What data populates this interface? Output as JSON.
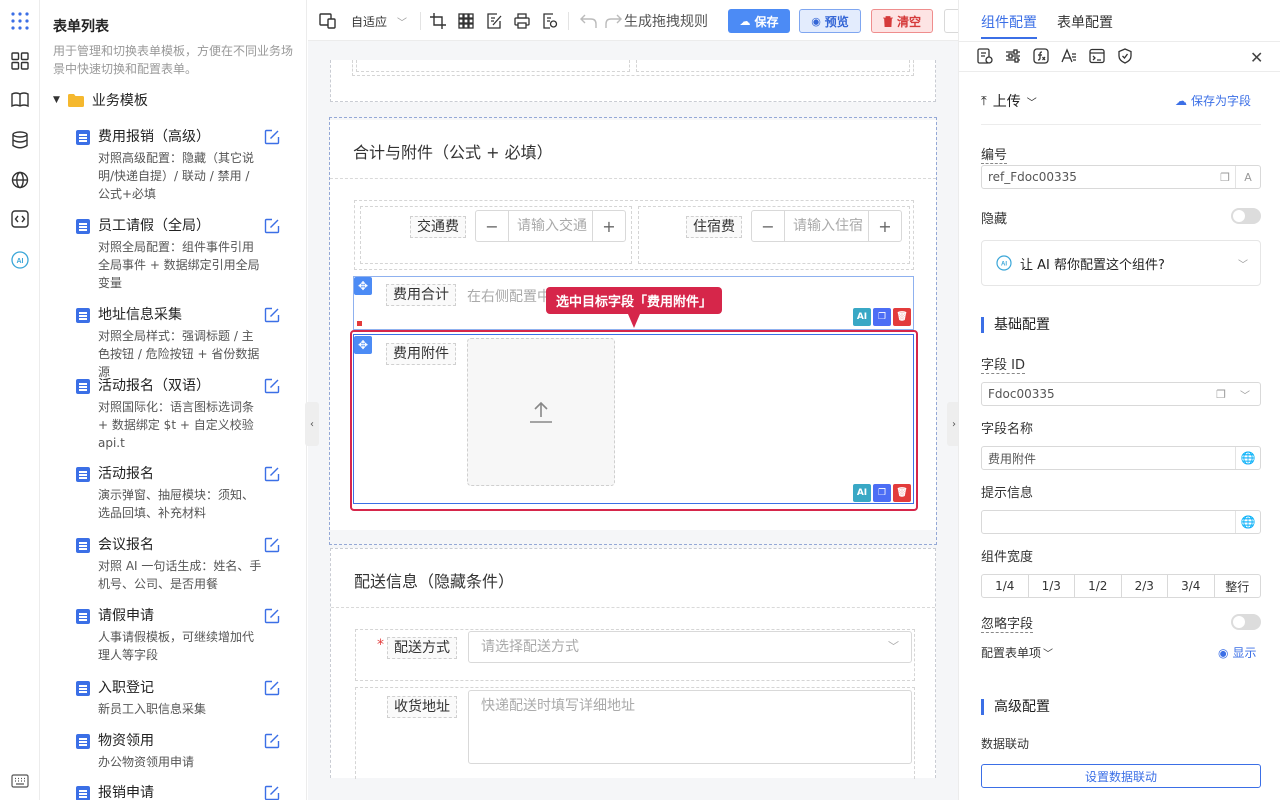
{
  "sidebar_list": {
    "title": "表单列表",
    "description": "用于管理和切换表单模板，方便在不同业务场景中快速切换和配置表单。",
    "group": "业务模板",
    "items": [
      {
        "name": "费用报销（高级）",
        "desc": "对照高级配置：隐藏（其它说明/快递自提）/ 联动 / 禁用 / 公式+必填"
      },
      {
        "name": "员工请假（全局）",
        "desc": "对照全局配置：组件事件引用全局事件 + 数据绑定引用全局变量"
      },
      {
        "name": "地址信息采集",
        "desc": "对照全局样式：强调标题 / 主色按钮 / 危险按钮 + 省份数据源"
      },
      {
        "name": "活动报名（双语）",
        "desc": "对照国际化：语言图标选词条 + 数据绑定 $t + 自定义校验 api.t"
      },
      {
        "name": "活动报名",
        "desc": "演示弹窗、抽屉模块：须知、选品回填、补充材料"
      },
      {
        "name": "会议报名",
        "desc": "对照 AI 一句话生成：姓名、手机号、公司、是否用餐"
      },
      {
        "name": "请假申请",
        "desc": "人事请假模板，可继续增加代理人等字段"
      },
      {
        "name": "入职登记",
        "desc": "新员工入职信息采集"
      },
      {
        "name": "物资领用",
        "desc": "办公物资领用申请"
      },
      {
        "name": "报销申请",
        "desc": ""
      }
    ]
  },
  "toolbar": {
    "layout_mode": "自适应",
    "rule_label": "生成拖拽规则",
    "save": "保存",
    "preview": "预览",
    "clear": "清空"
  },
  "canvas": {
    "section1_title": "合计与附件（公式 + 必填）",
    "transport_label": "交通费",
    "transport_placeholder": "请输入交通",
    "hotel_label": "住宿费",
    "hotel_placeholder": "请输入住宿",
    "total_label": "费用合计",
    "total_hint": "在右侧配置中",
    "attachment_label": "费用附件",
    "callout": "选中目标字段「费用附件」",
    "ai_badge": "AI",
    "section2_title": "配送信息（隐藏条件）",
    "delivery_required": "*",
    "delivery_label": "配送方式",
    "delivery_placeholder": "请选择配送方式",
    "address_label": "收货地址",
    "address_placeholder": "快递配送时填写详细地址",
    "minus": "−",
    "plus": "+"
  },
  "right_panel": {
    "tab_component": "组件配置",
    "tab_form": "表单配置",
    "upload_label": "上传",
    "save_as_field": "保存为字段",
    "ref_label": "编号",
    "ref_value": "ref_Fdoc00335",
    "hidden_label": "隐藏",
    "ai_help": "让 AI 帮你配置这个组件?",
    "basic_section": "基础配置",
    "field_id_label": "字段 ID",
    "field_id_value": "Fdoc00335",
    "field_name_label": "字段名称",
    "field_name_value": "费用附件",
    "tip_label": "提示信息",
    "tip_value": "",
    "width_label": "组件宽度",
    "width_options": [
      "1/4",
      "1/3",
      "1/2",
      "2/3",
      "3/4",
      "整行"
    ],
    "ignore_label": "忽略字段",
    "form_items_label": "配置表单项",
    "show_label": "显示",
    "advanced_section": "高级配置",
    "linkage_label": "数据联动",
    "linkage_button": "设置数据联动"
  },
  "colors": {
    "primary": "#3b6fe6",
    "callout": "#d6264a",
    "danger": "#e33b3b"
  }
}
